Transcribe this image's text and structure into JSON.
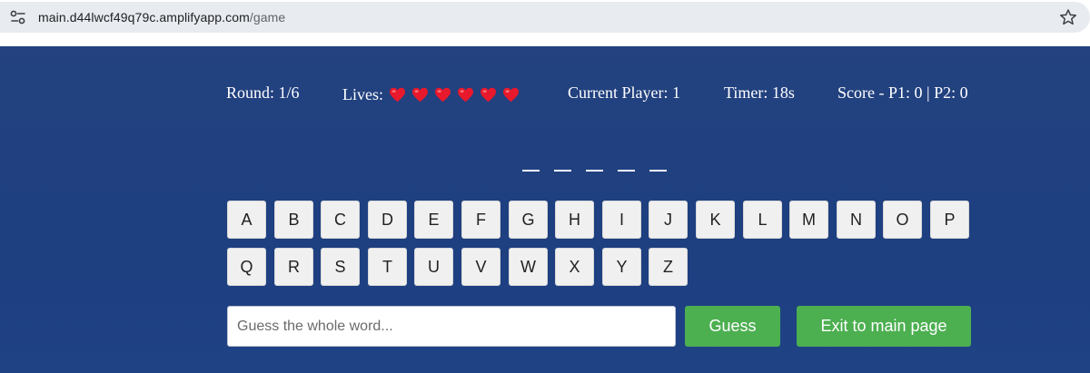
{
  "browser": {
    "url_host": "main.d44lwcf49q79c.amplifyapp.com",
    "url_path": "/game"
  },
  "stats": {
    "round": "Round: 1/6",
    "lives_label": "Lives:",
    "lives_count": 6,
    "current_player": "Current Player: 1",
    "timer": "Timer: 18s",
    "score": "Score - P1: 0 | P2: 0"
  },
  "word": {
    "blanks": [
      "_",
      "_",
      "_",
      "_",
      "_"
    ]
  },
  "keyboard": {
    "row1": [
      "A",
      "B",
      "C",
      "D",
      "E",
      "F",
      "G",
      "H",
      "I",
      "J",
      "K",
      "L",
      "M",
      "N",
      "O",
      "P"
    ],
    "row2": [
      "Q",
      "R",
      "S",
      "T",
      "U",
      "V",
      "W",
      "X",
      "Y",
      "Z"
    ]
  },
  "guess": {
    "placeholder": "Guess the whole word...",
    "value": "",
    "guess_label": "Guess",
    "exit_label": "Exit to main page"
  },
  "colors": {
    "background": "#22417f",
    "button_green": "#4caf50",
    "heart": "#e8192c"
  },
  "icons": {
    "site_info": "tune-icon",
    "bookmark": "star-icon",
    "life": "heart-icon"
  }
}
